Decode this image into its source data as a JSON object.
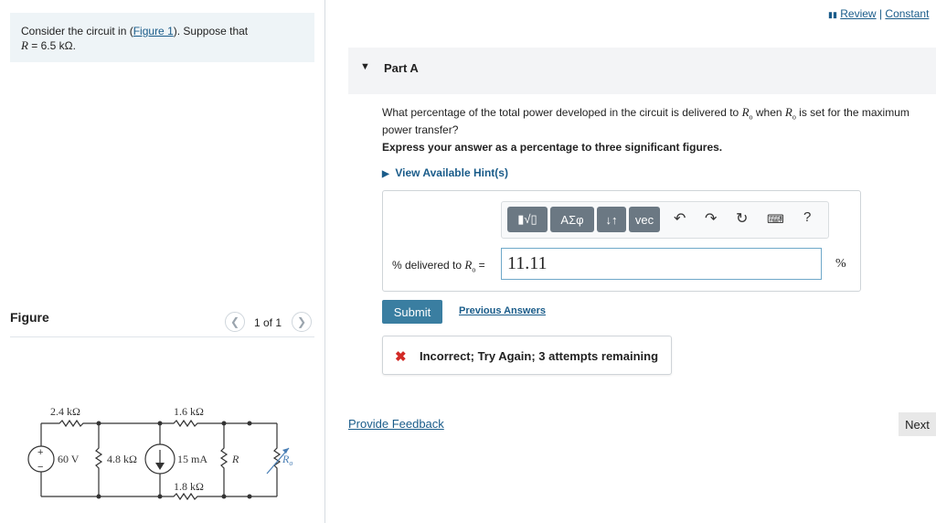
{
  "problem": {
    "line1_prefix": "Consider the circuit in (",
    "figure_link": "Figure 1",
    "line1_suffix": "). Suppose that",
    "line2_var": "R",
    "line2_rest": " = 6.5 kΩ."
  },
  "figure": {
    "title": "Figure",
    "pager": "1 of 1",
    "circuit": {
      "r_24": "2.4 kΩ",
      "r_16": "1.6 kΩ",
      "v_source": "60 V",
      "r_48": "4.8 kΩ",
      "i_source": "15 mA",
      "r_var": "R",
      "r_18": "1.8 kΩ",
      "r_load": "R",
      "r_load_sub": "o",
      "plus": "+",
      "minus": "−"
    }
  },
  "topnav": {
    "review": "Review",
    "sep": " | ",
    "constants": "Constant"
  },
  "part": {
    "title": "Part A",
    "question_1": "What percentage of the total power developed in the circuit is delivered to ",
    "question_var": "R",
    "question_sub": "o",
    "question_2": " when ",
    "question_3": " is set for the maximum power transfer?",
    "instruction": "Express your answer as a percentage to three significant figures.",
    "hint": "View Available Hint(s)"
  },
  "toolbar": {
    "templates": "▮√▯",
    "greek": "ΑΣφ",
    "arrows": "↓↑",
    "vec": "vec",
    "help": "?"
  },
  "answer": {
    "label_prefix": "% delivered to ",
    "label_var": "R",
    "label_sub": "o",
    "label_suffix": " =",
    "value": "11.11",
    "unit": "%"
  },
  "actions": {
    "submit": "Submit",
    "previous_answers": "Previous Answers"
  },
  "feedback": {
    "icon": "✖",
    "text": "Incorrect; Try Again; 3 attempts remaining"
  },
  "footer": {
    "provide_feedback": "Provide Feedback",
    "next": "Next"
  }
}
